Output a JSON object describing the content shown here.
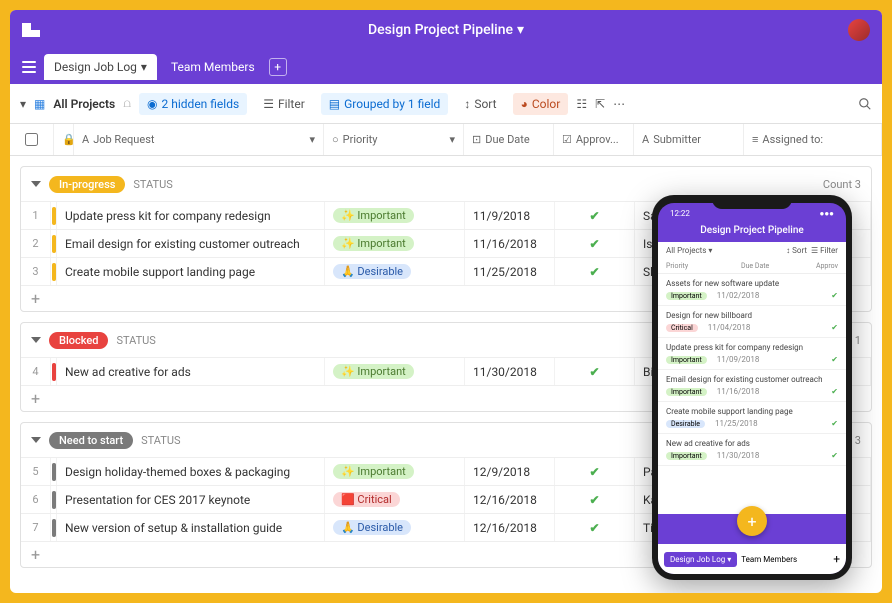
{
  "header": {
    "title": "Design Project Pipeline"
  },
  "tabs": {
    "active": "Design Job Log",
    "inactive": "Team Members"
  },
  "toolbar": {
    "view": "All Projects",
    "hidden": "2 hidden fields",
    "filter": "Filter",
    "group": "Grouped by 1 field",
    "sort": "Sort",
    "color": "Color"
  },
  "columns": {
    "c1": "Job Request",
    "c2": "Priority",
    "c3": "Due Date",
    "c4": "Approv...",
    "c5": "Submitter",
    "c6": "Assigned to:"
  },
  "status_label": "STATUS",
  "count_label": "Count",
  "groups": [
    {
      "name": "In-progress",
      "color": "#f4b71e",
      "count": "3",
      "rows": [
        {
          "n": "1",
          "bar": "#f4b71e",
          "req": "Update press kit for company redesign",
          "prio": "Important",
          "pcolor": "#d4f2c6",
          "ptext": "#4a7a2e",
          "due": "11/9/2018",
          "sub": "Sarah Grimaldi"
        },
        {
          "n": "2",
          "bar": "#f4b71e",
          "req": "Email design for existing customer outreach",
          "prio": "Important",
          "pcolor": "#d4f2c6",
          "ptext": "#4a7a2e",
          "due": "11/16/2018",
          "sub": "Issra"
        },
        {
          "n": "3",
          "bar": "#f4b71e",
          "req": "Create mobile support landing page",
          "prio": "Desirable",
          "pcolor": "#d8e6fb",
          "ptext": "#2a5aa8",
          "due": "11/25/2018",
          "sub": "Shor"
        }
      ]
    },
    {
      "name": "Blocked",
      "color": "#e8433f",
      "count": "1",
      "rows": [
        {
          "n": "4",
          "bar": "#e8433f",
          "req": "New ad creative for ads",
          "prio": "Important",
          "pcolor": "#d4f2c6",
          "ptext": "#4a7a2e",
          "due": "11/30/2018",
          "sub": "Billy"
        }
      ]
    },
    {
      "name": "Need to start",
      "color": "#7a7a7a",
      "count": "3",
      "rows": [
        {
          "n": "5",
          "bar": "#7a7a7a",
          "req": "Design holiday-themed boxes & packaging",
          "prio": "Important",
          "pcolor": "#d4f2c6",
          "ptext": "#4a7a2e",
          "due": "12/9/2018",
          "sub": "Patri"
        },
        {
          "n": "6",
          "bar": "#7a7a7a",
          "req": "Presentation for CES 2017 keynote",
          "prio": "Critical",
          "pcolor": "#fbd6d6",
          "ptext": "#b22a2a",
          "due": "12/16/2018",
          "sub": "Karin"
        },
        {
          "n": "7",
          "bar": "#7a7a7a",
          "req": "New version of setup & installation guide",
          "prio": "Desirable",
          "pcolor": "#d8e6fb",
          "ptext": "#2a5aa8",
          "due": "12/16/2018",
          "sub": "Timo"
        }
      ]
    }
  ],
  "phone": {
    "time": "12:22",
    "title": "Design Project Pipeline",
    "view": "All Projects",
    "sort": "Sort",
    "filter": "Filter",
    "cols": {
      "c1": "Priority",
      "c2": "Due Date",
      "c3": "Approv"
    },
    "items": [
      {
        "t": "Assets for new software update",
        "p": "Important",
        "pc": "#d4f2c6",
        "d": "11/02/2018"
      },
      {
        "t": "Design for new billboard",
        "p": "Critical",
        "pc": "#fbd6d6",
        "d": "11/04/2018"
      },
      {
        "t": "Update press kit for company redesign",
        "p": "Important",
        "pc": "#d4f2c6",
        "d": "11/09/2018"
      },
      {
        "t": "Email design for existing customer outreach",
        "p": "Important",
        "pc": "#d4f2c6",
        "d": "11/16/2018"
      },
      {
        "t": "Create mobile support landing page",
        "p": "Desirable",
        "pc": "#d8e6fb",
        "d": "11/25/2018"
      },
      {
        "t": "New ad creative for ads",
        "p": "Important",
        "pc": "#d4f2c6",
        "d": "11/30/2018"
      }
    ],
    "tab1": "Design Job Log",
    "tab2": "Team Members"
  }
}
